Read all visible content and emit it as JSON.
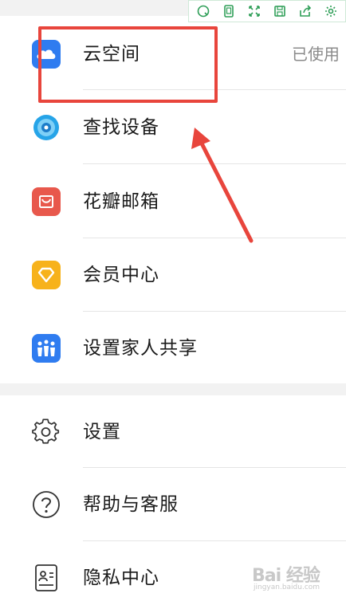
{
  "menu_primary": [
    {
      "label": "云空间",
      "value": "已使用",
      "icon": "cloud-space-icon"
    },
    {
      "label": "查找设备",
      "icon": "find-device-icon"
    },
    {
      "label": "花瓣邮箱",
      "icon": "petal-mail-icon"
    },
    {
      "label": "会员中心",
      "icon": "member-center-icon"
    },
    {
      "label": "设置家人共享",
      "icon": "family-sharing-icon"
    }
  ],
  "menu_secondary": [
    {
      "label": "设置",
      "icon": "gear-icon"
    },
    {
      "label": "帮助与客服",
      "icon": "help-icon"
    },
    {
      "label": "隐私中心",
      "icon": "privacy-icon"
    }
  ],
  "toolbar": {
    "icons": [
      "search-icon",
      "copy-icon",
      "fullscreen-icon",
      "save-icon",
      "share-icon",
      "settings-icon"
    ],
    "color": "#2e9e57"
  },
  "annotation_color": "#e8453c",
  "watermark": {
    "main": "Bai 经验",
    "sub": "jingyan.baidu.com"
  }
}
